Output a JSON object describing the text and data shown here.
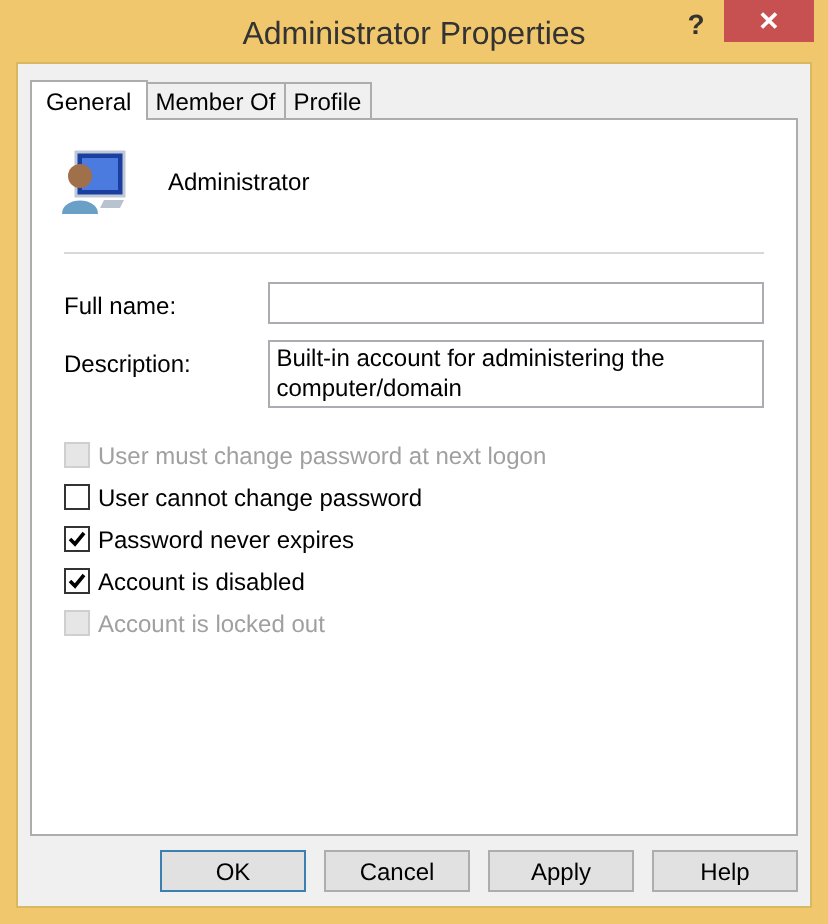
{
  "window": {
    "title": "Administrator Properties",
    "help_button": "?",
    "close_button": "✕"
  },
  "tabs": [
    {
      "label": "General",
      "selected": true
    },
    {
      "label": "Member Of",
      "selected": false
    },
    {
      "label": "Profile",
      "selected": false
    }
  ],
  "user": {
    "name": "Administrator"
  },
  "fields": [
    {
      "label": "Full name:",
      "kind": "single"
    },
    {
      "label": "Description:",
      "value": "Built-in account for administering the computer/domain",
      "kind": "multi"
    }
  ],
  "options": [
    {
      "label": "User must change password at next logon",
      "checked": false,
      "disabled": true
    },
    {
      "label": "User cannot change password",
      "checked": false,
      "disabled": false
    },
    {
      "label": "Password never expires",
      "checked": true,
      "disabled": false
    },
    {
      "label": "Account is disabled",
      "checked": true,
      "disabled": false
    },
    {
      "label": "Account is locked out",
      "checked": false,
      "disabled": true
    }
  ],
  "buttons": [
    {
      "label": "OK",
      "default": true
    },
    {
      "label": "Cancel",
      "default": false
    },
    {
      "label": "Apply",
      "default": false
    },
    {
      "label": "Help",
      "default": false
    }
  ]
}
